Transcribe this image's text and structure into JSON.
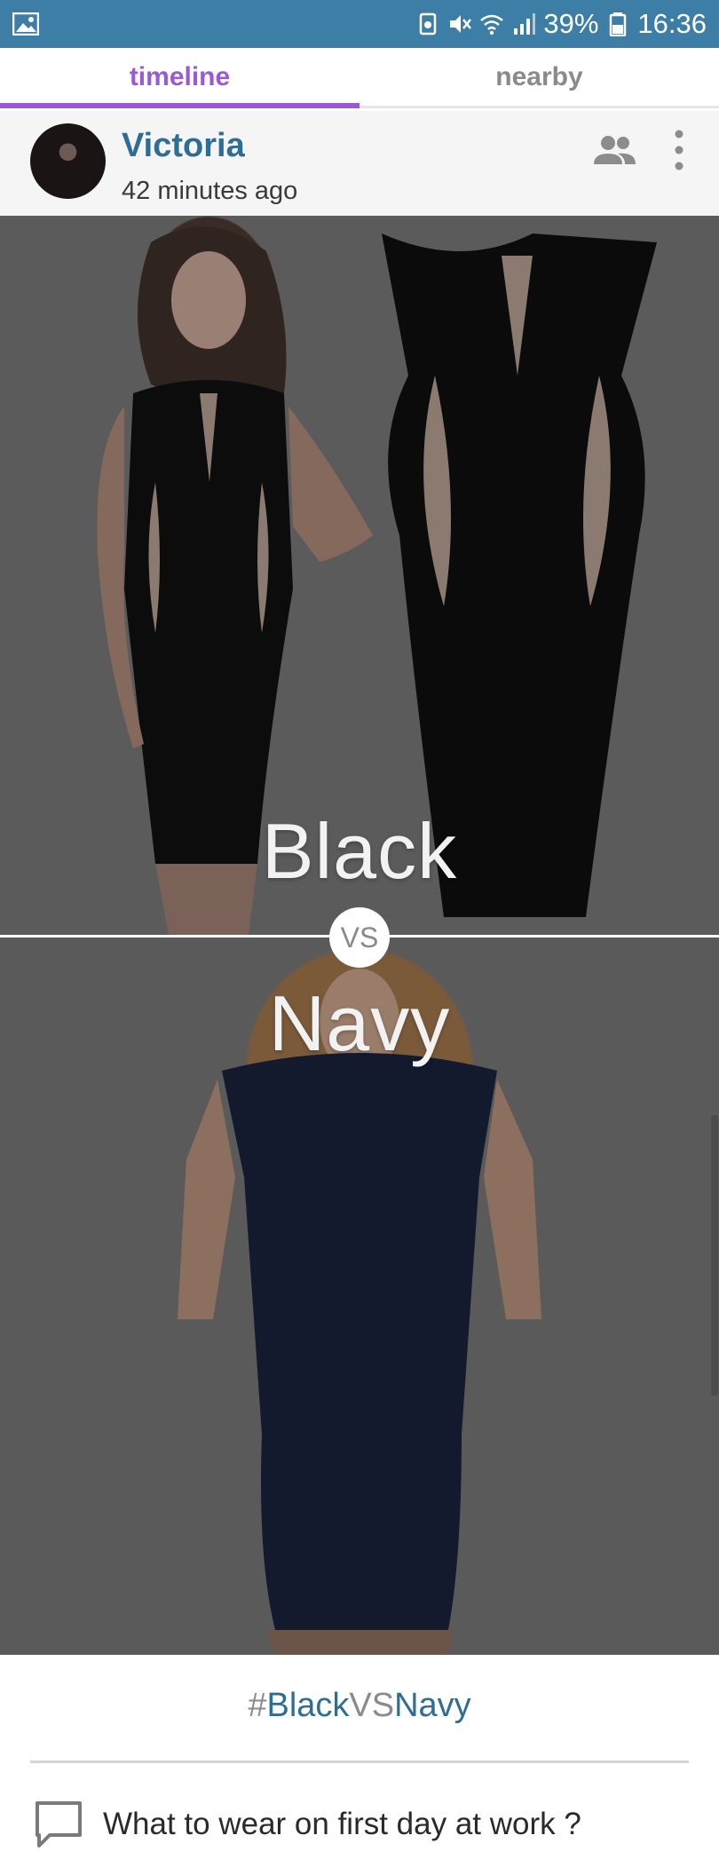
{
  "status_bar": {
    "battery": "39%",
    "time": "16:36"
  },
  "tabs": [
    {
      "label": "timeline",
      "active": true
    },
    {
      "label": "nearby",
      "active": false
    }
  ],
  "post": {
    "username": "Victoria",
    "timestamp": "42 minutes ago",
    "options": {
      "first": "Black",
      "second": "Navy",
      "vs": "VS"
    },
    "hashtag": {
      "hash": "#",
      "first": "Black",
      "vs": "VS",
      "second": "Navy"
    },
    "question": "What to wear on first day at work ?"
  },
  "colors": {
    "status_bar": "#3d7ea6",
    "tab_active": "#9b59d6",
    "username": "#2f6e94"
  },
  "icons": {
    "status_left": "gallery-icon",
    "header_actions": [
      "group-icon",
      "more-vert-icon"
    ],
    "question": "comment-icon"
  }
}
